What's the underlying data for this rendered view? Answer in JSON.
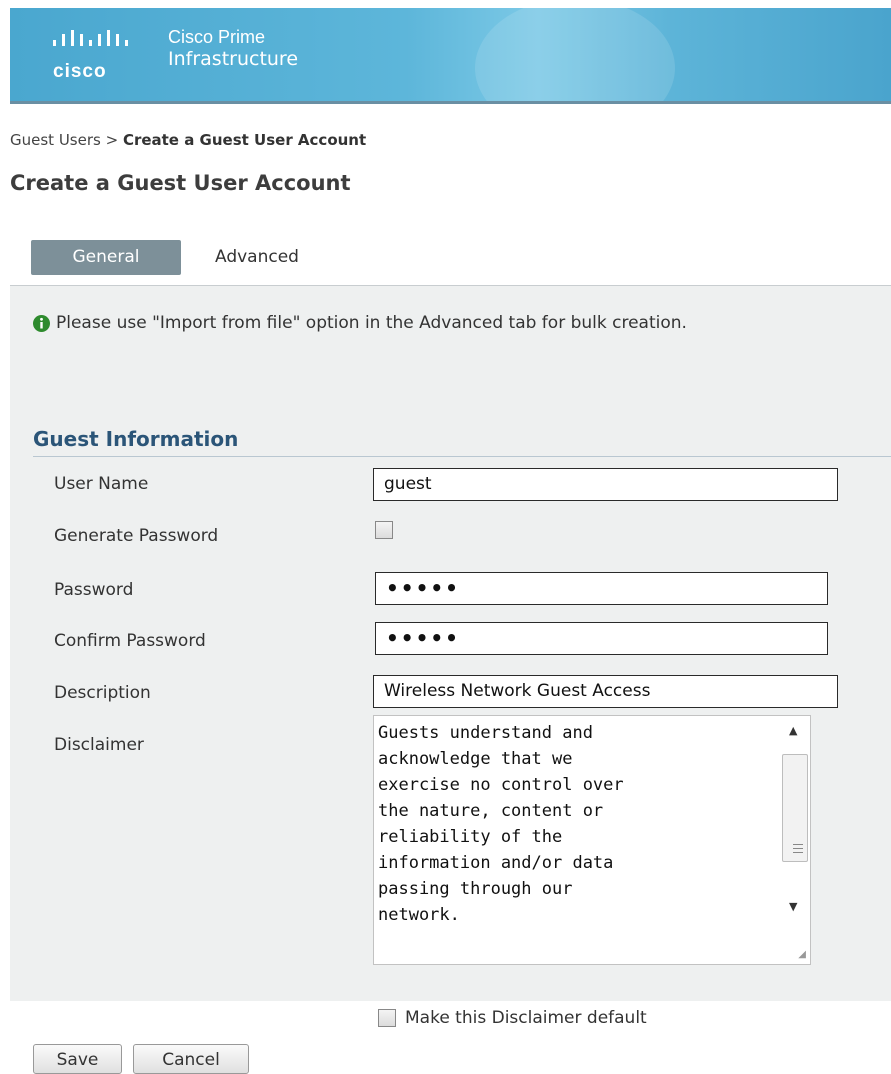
{
  "header": {
    "logo_text": "cisco",
    "product_line1": "Cisco Prime",
    "product_line2": "Infrastructure"
  },
  "breadcrumb": {
    "parent": "Guest Users",
    "separator": " > ",
    "current": "Create a Guest User Account"
  },
  "page_title": "Create a Guest User Account",
  "tabs": [
    {
      "label": "General",
      "active": true
    },
    {
      "label": "Advanced",
      "active": false
    }
  ],
  "info_message": "Please use \"Import from file\" option in the Advanced tab for bulk creation.",
  "section": {
    "title": "Guest Information",
    "fields": {
      "user_name": {
        "label": "User Name",
        "value": "guest"
      },
      "generate_password": {
        "label": "Generate Password",
        "checked": false
      },
      "password": {
        "label": "Password",
        "value": "•••••"
      },
      "confirm_password": {
        "label": "Confirm Password",
        "value": "•••••"
      },
      "description": {
        "label": "Description",
        "value": "Wireless Network Guest Access"
      },
      "disclaimer": {
        "label": "Disclaimer",
        "value": "Guests understand and\nacknowledge that we\nexercise no control over\nthe nature, content or\nreliability of the\ninformation and/or data\npassing through our\nnetwork."
      },
      "make_default": {
        "label": "Make this Disclaimer default",
        "checked": false
      }
    }
  },
  "buttons": {
    "save": "Save",
    "cancel": "Cancel"
  },
  "colors": {
    "header_blue": "#4aa7cf",
    "active_tab": "#7d9099",
    "section_title": "#2b5578",
    "info_icon": "#2e8b2e"
  }
}
